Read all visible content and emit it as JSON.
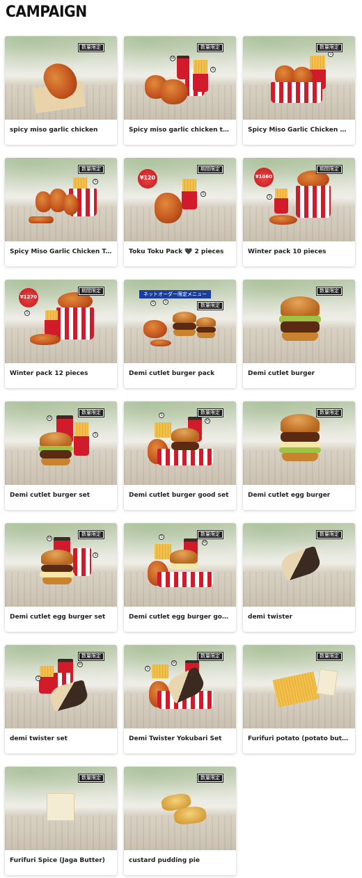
{
  "page": {
    "title": "CAMPAIGN"
  },
  "badges": {
    "limited_qty": "数量限定",
    "limited_period": "期間限定"
  },
  "overlays": {
    "net_order_banner": "ネットオーダー限定メニュー",
    "price_120": "¥120",
    "price_1060": "¥1060",
    "price_1270": "¥1270"
  },
  "items": [
    {
      "name": "spicy miso garlic chicken",
      "badge": "数量限定"
    },
    {
      "name": "Spicy miso garlic chicken tasting set",
      "badge": "数量限定"
    },
    {
      "name": "Spicy Miso Garlic Chicken Compare Pack",
      "badge": "数量限定"
    },
    {
      "name": "Spicy Miso Garlic Chicken Tasting Pack",
      "badge": "数量限定"
    },
    {
      "name": "Toku Toku Pack 🖤 2 pieces",
      "badge": "期間限定"
    },
    {
      "name": "Winter pack 10 pieces",
      "badge": "期間限定"
    },
    {
      "name": "Winter pack 12 pieces",
      "badge": "期間限定"
    },
    {
      "name": "Demi cutlet burger pack",
      "badge": "数量限定"
    },
    {
      "name": "Demi cutlet burger",
      "badge": "数量限定"
    },
    {
      "name": "Demi cutlet burger set",
      "badge": "数量限定"
    },
    {
      "name": "Demi cutlet burger good set",
      "badge": "数量限定"
    },
    {
      "name": "Demi cutlet egg burger",
      "badge": "数量限定"
    },
    {
      "name": "Demi cutlet egg burger set",
      "badge": "数量限定"
    },
    {
      "name": "Demi cutlet egg burger good set",
      "badge": "数量限定"
    },
    {
      "name": "demi twister",
      "badge": "数量限定"
    },
    {
      "name": "demi twister set",
      "badge": "数量限定"
    },
    {
      "name": "Demi Twister Yokubari Set",
      "badge": "数量限定"
    },
    {
      "name": "Furifuri potato (potato butter)",
      "badge": "数量限定"
    },
    {
      "name": "Furifuri Spice (Jaga Butter)",
      "badge": "数量限定"
    },
    {
      "name": "custard pudding pie",
      "badge": "数量限定"
    }
  ]
}
